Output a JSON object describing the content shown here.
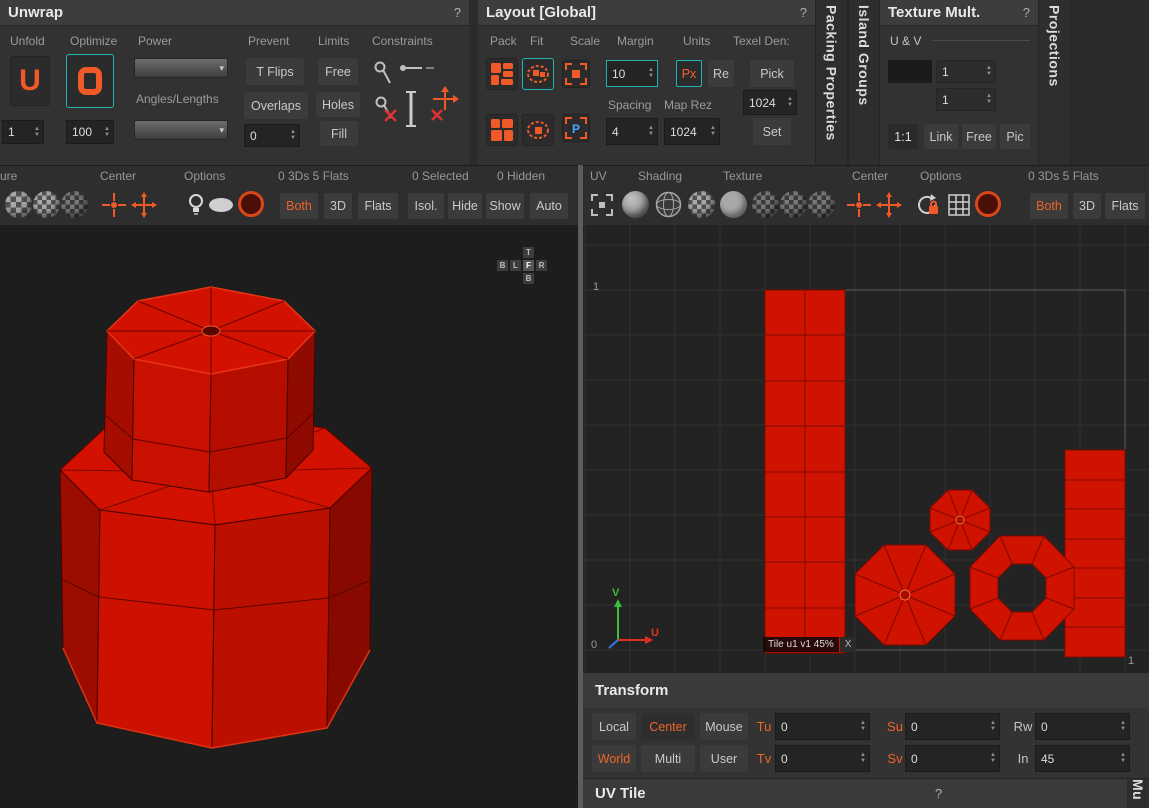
{
  "unwrap": {
    "title": "Unwrap",
    "help": "?",
    "labels": {
      "unfold": "Unfold",
      "optimize": "Optimize",
      "power": "Power",
      "prevent": "Prevent",
      "limits": "Limits",
      "constraints": "Constraints",
      "angles": "Angles/Lengths"
    },
    "unfold_value": "1",
    "optimize_value": "100",
    "overlaps_value": "0",
    "buttons": {
      "tflips": "T Flips",
      "overlaps": "Overlaps",
      "free": "Free",
      "holes": "Holes",
      "fill": "Fill"
    }
  },
  "layout": {
    "title": "Layout [Global]",
    "help": "?",
    "labels": {
      "pack": "Pack",
      "fit": "Fit",
      "scale": "Scale",
      "margin": "Margin",
      "units": "Units",
      "texel": "Texel Den:",
      "spacing": "Spacing",
      "maprez": "Map Rez"
    },
    "margin_value": "10",
    "px": "Px",
    "re": "Re",
    "pick": "Pick",
    "set": "Set",
    "spacing_value": "4",
    "maprez_value": "1024",
    "texel_value": "1024"
  },
  "texture_mult": {
    "title": "Texture Mult.",
    "help": "?",
    "uv_label": "U & V",
    "u_value": "1",
    "v_value": "1",
    "buttons": {
      "ratio": "1:1",
      "link": "Link",
      "free": "Free",
      "pic": "Pic"
    }
  },
  "vertical_tabs": {
    "packing": "Packing Properties",
    "island": "Island Groups",
    "projections": "Projections",
    "multi": "Mu"
  },
  "toolbar3d": {
    "label_texture": "ure",
    "label_center": "Center",
    "label_options": "Options",
    "count_flats": "0 3Ds 5 Flats",
    "count_selected": "0 Selected",
    "count_hidden": "0 Hidden",
    "both": "Both",
    "b3d": "3D",
    "flats": "Flats",
    "isol": "Isol.",
    "hide": "Hide",
    "show": "Show",
    "auto": "Auto"
  },
  "toolbaruv": {
    "label_uv": "UV",
    "label_shading": "Shading",
    "label_texture": "Texture",
    "label_center": "Center",
    "label_options": "Options",
    "count_flats": "0 3Ds 5 Flats",
    "both": "Both",
    "b3d": "3D",
    "flats": "Flats"
  },
  "viewport3d": {
    "gizmo": {
      "top": "T",
      "back": "B",
      "left": "L",
      "front": "F",
      "right": "R",
      "bottom": "B"
    }
  },
  "uv_viewport": {
    "tick_top": "1",
    "tick_zero": "0",
    "tick_right": "1",
    "axis_v": "V",
    "axis_u": "U",
    "tile_label": "Tile u1 v1 45%",
    "tile_close": "X"
  },
  "transform": {
    "title": "Transform",
    "row1": {
      "b1": "Local",
      "b2": "Center",
      "b3": "Mouse",
      "l1": "Tu",
      "v1": "0",
      "l2": "Su",
      "v2": "0",
      "l3": "Rw",
      "v3": "0"
    },
    "row2": {
      "b1": "World",
      "b2": "Multi",
      "b3": "User",
      "l1": "Tv",
      "v1": "0",
      "l2": "Sv",
      "v2": "0",
      "l3": "In",
      "v3": "45"
    }
  },
  "uv_tile": {
    "title": "UV Tile",
    "help": "?"
  }
}
